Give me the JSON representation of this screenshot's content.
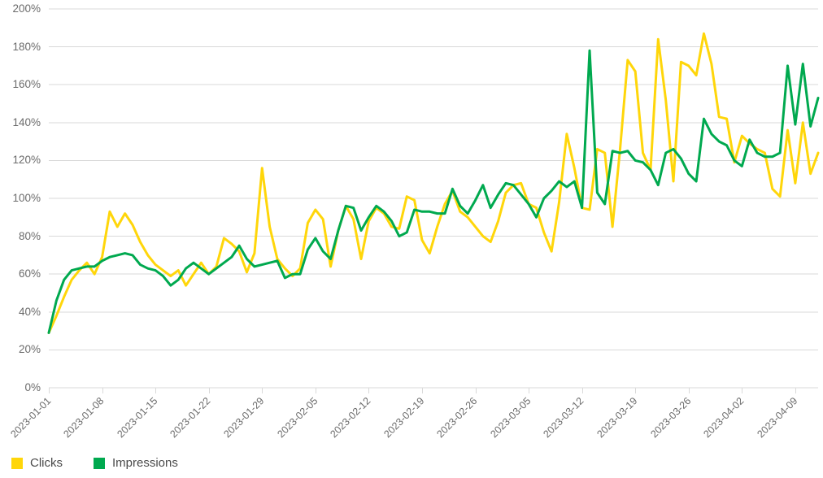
{
  "chart_data": {
    "type": "line",
    "title": "",
    "subtitle": "",
    "xlabel": "",
    "ylabel": "",
    "ylim": [
      0,
      200
    ],
    "y_unit": "%",
    "grid": true,
    "legend_position": "bottom-left",
    "x_tick_labels": [
      "2023-01-01",
      "2023-01-08",
      "2023-01-15",
      "2023-01-22",
      "2023-01-29",
      "2023-02-05",
      "2023-02-12",
      "2023-02-19",
      "2023-02-26",
      "2023-03-05",
      "2023-03-12",
      "2023-03-19",
      "2023-03-26",
      "2023-04-02",
      "2023-04-09"
    ],
    "y_tick_labels": [
      "0%",
      "20%",
      "40%",
      "60%",
      "80%",
      "100%",
      "120%",
      "140%",
      "160%",
      "180%",
      "200%"
    ],
    "y_tick_values": [
      0,
      20,
      40,
      60,
      80,
      100,
      120,
      140,
      160,
      180,
      200
    ],
    "x_start_date": "2023-01-01",
    "x_end_date": "2023-04-10",
    "x_tick_interval_days": 7,
    "series": [
      {
        "name": "Clicks",
        "color": "#FFD60A",
        "values": [
          29,
          38,
          48,
          57,
          62,
          66,
          60,
          69,
          93,
          85,
          92,
          86,
          77,
          70,
          65,
          62,
          59,
          62,
          54,
          60,
          66,
          60,
          64,
          79,
          76,
          72,
          61,
          71,
          116,
          85,
          68,
          63,
          59,
          63,
          87,
          94,
          89,
          64,
          83,
          96,
          89,
          68,
          88,
          95,
          92,
          85,
          84,
          101,
          99,
          78,
          71,
          85,
          97,
          104,
          93,
          90,
          85,
          80,
          77,
          88,
          103,
          107,
          108,
          97,
          95,
          82,
          72,
          98,
          134,
          116,
          95,
          94,
          126,
          124,
          85,
          126,
          173,
          167,
          124,
          115,
          184,
          152,
          109,
          172,
          170,
          165,
          187,
          171,
          143,
          142,
          119,
          133,
          129,
          126,
          124,
          105,
          101,
          136,
          108,
          140,
          113,
          124
        ]
      },
      {
        "name": "Impressions",
        "color": "#00A94F",
        "values": [
          29,
          46,
          57,
          62,
          63,
          64,
          64,
          67,
          69,
          70,
          71,
          70,
          65,
          63,
          62,
          59,
          54,
          57,
          63,
          66,
          63,
          60,
          63,
          66,
          69,
          75,
          68,
          64,
          65,
          66,
          67,
          58,
          60,
          60,
          73,
          79,
          72,
          68,
          83,
          96,
          95,
          83,
          90,
          96,
          93,
          88,
          80,
          82,
          94,
          93,
          93,
          92,
          92,
          105,
          96,
          92,
          99,
          107,
          95,
          102,
          108,
          107,
          102,
          97,
          90,
          100,
          104,
          109,
          106,
          109,
          95,
          178,
          103,
          97,
          125,
          124,
          125,
          120,
          119,
          115,
          107,
          124,
          126,
          121,
          113,
          109,
          142,
          134,
          130,
          128,
          120,
          117,
          131,
          124,
          122,
          122,
          124,
          170,
          139,
          171,
          138,
          153
        ]
      }
    ]
  },
  "legend": {
    "items": [
      {
        "label": "Clicks",
        "color": "#FFD60A",
        "swatch": "square-swatch"
      },
      {
        "label": "Impressions",
        "color": "#00A94F",
        "swatch": "square-swatch"
      }
    ]
  },
  "axes": {
    "grid_color": "#d9d9d9",
    "tick_color": "#d9d9d9",
    "label_color": "#6b6b6b"
  }
}
